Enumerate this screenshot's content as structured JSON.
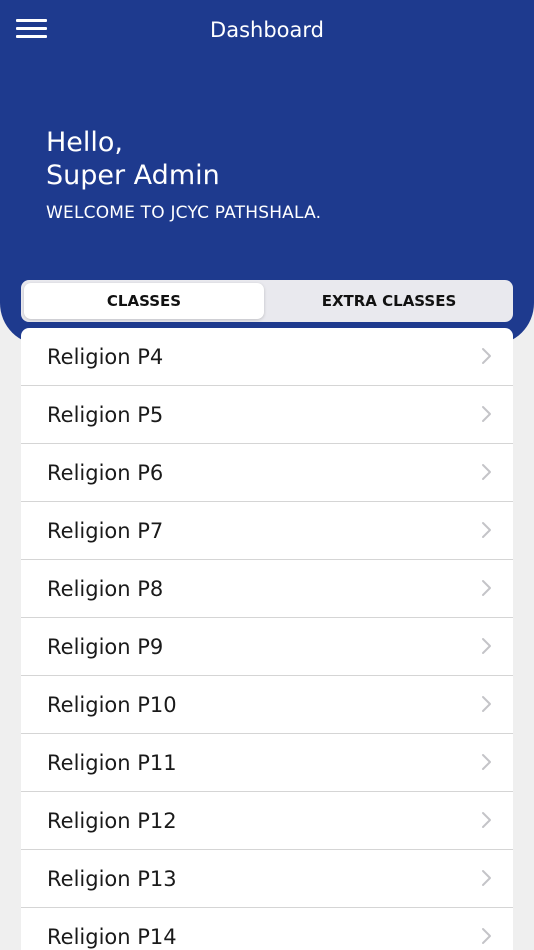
{
  "header": {
    "title": "Dashboard",
    "menu_icon": "hamburger-menu-icon",
    "greeting_line1": "Hello,",
    "greeting_line2": "Super Admin",
    "welcome": "WELCOME TO JCYC PATHSHALA."
  },
  "tabs": [
    {
      "label": "CLASSES",
      "selected": true
    },
    {
      "label": "EXTRA CLASSES",
      "selected": false
    }
  ],
  "classes": [
    {
      "label": "Religion P4"
    },
    {
      "label": "Religion P5"
    },
    {
      "label": "Religion P6"
    },
    {
      "label": "Religion P7"
    },
    {
      "label": "Religion P8"
    },
    {
      "label": "Religion P9"
    },
    {
      "label": "Religion P10"
    },
    {
      "label": "Religion P11"
    },
    {
      "label": "Religion P12"
    },
    {
      "label": "Religion P13"
    },
    {
      "label": "Religion P14"
    }
  ],
  "row_icon": "chevron-right-icon",
  "colors": {
    "primary": "#1e3a8e",
    "background": "#efefef",
    "chevron": "#c4c4c8"
  }
}
